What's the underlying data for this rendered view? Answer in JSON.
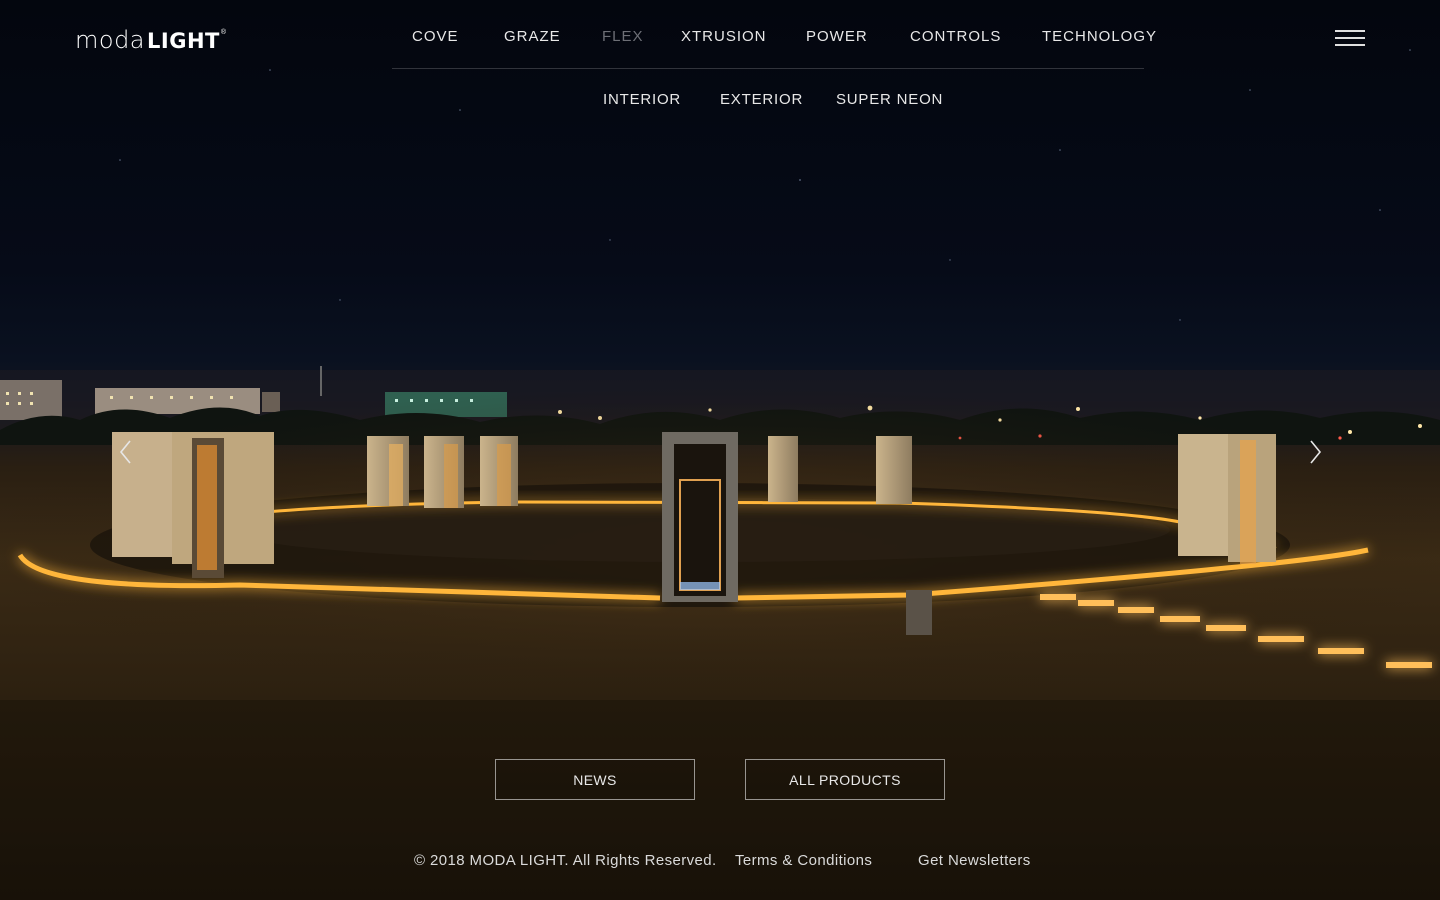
{
  "brand": {
    "logo_light": "moda",
    "logo_bold": "LIGHT",
    "logo_mark": "®"
  },
  "nav": {
    "items": [
      {
        "label": "COVE"
      },
      {
        "label": "GRAZE"
      },
      {
        "label": "FLEX",
        "active": true
      },
      {
        "label": "XTRUSION"
      },
      {
        "label": "POWER"
      },
      {
        "label": "CONTROLS"
      },
      {
        "label": "TECHNOLOGY"
      }
    ]
  },
  "subnav": {
    "items": [
      {
        "label": "INTERIOR"
      },
      {
        "label": "EXTERIOR"
      },
      {
        "label": "SUPER NEON"
      }
    ]
  },
  "menu_icon": "hamburger-menu-icon",
  "slider": {
    "prev_icon": "chevron-left-icon",
    "next_icon": "chevron-right-icon"
  },
  "cta": {
    "news_label": "NEWS",
    "products_label": "ALL PRODUCTS"
  },
  "footer": {
    "copyright": "© 2018 MODA LIGHT. All Rights Reserved.",
    "terms_label": "Terms & Conditions",
    "newsletter_label": "Get Newsletters"
  },
  "colors": {
    "glow": "#ffb63a",
    "nav_active": "#6d6f76",
    "text": "#e8e8e8"
  }
}
